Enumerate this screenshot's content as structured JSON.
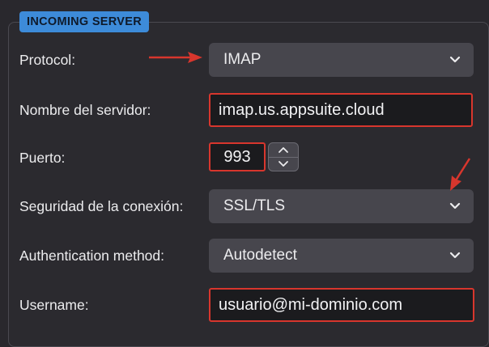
{
  "section": {
    "title": "INCOMING SERVER"
  },
  "fields": {
    "protocol": {
      "label": "Protocol:",
      "value": "IMAP"
    },
    "server": {
      "label": "Nombre del servidor:",
      "value": "imap.us.appsuite.cloud"
    },
    "port": {
      "label": "Puerto:",
      "value": "993"
    },
    "security": {
      "label": "Seguridad de la conexión:",
      "value": "SSL/TLS"
    },
    "auth": {
      "label": "Authentication method:",
      "value": "Autodetect"
    },
    "username": {
      "label": "Username:",
      "value": "usuario@mi-dominio.com"
    }
  },
  "colors": {
    "background": "#29282d",
    "badge": "#3d8bd9",
    "select_bg": "#47464d",
    "highlight_border": "#d8362d",
    "annotation_arrow": "#d8362d"
  },
  "icons": {
    "select_indicator": "chevron-down-icon",
    "stepper_up": "chevron-up-icon",
    "stepper_down": "chevron-down-icon",
    "annotation": "red-arrow-icon"
  }
}
